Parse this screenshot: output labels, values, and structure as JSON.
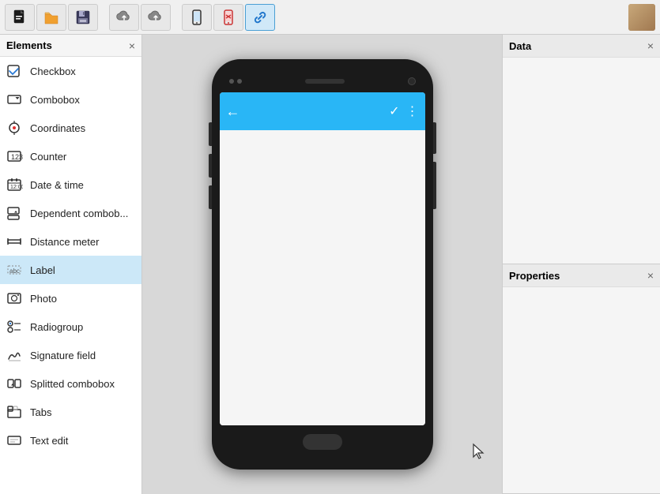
{
  "toolbar": {
    "buttons": [
      {
        "id": "new-file",
        "icon": "📄",
        "label": "New"
      },
      {
        "id": "open-folder",
        "icon": "📂",
        "label": "Open"
      },
      {
        "id": "save",
        "icon": "💾",
        "label": "Save"
      },
      {
        "id": "upload1",
        "icon": "☁",
        "label": "Upload1"
      },
      {
        "id": "upload2",
        "icon": "☁",
        "label": "Upload2"
      },
      {
        "id": "mobile-view",
        "icon": "📱",
        "label": "Mobile View"
      },
      {
        "id": "close-view",
        "icon": "🚫",
        "label": "Close View"
      },
      {
        "id": "link",
        "icon": "🔗",
        "label": "Link",
        "active": true
      }
    ]
  },
  "elements_panel": {
    "title": "Elements",
    "close_label": "×",
    "items": [
      {
        "id": "checkbox",
        "label": "Checkbox",
        "icon": "checkbox"
      },
      {
        "id": "combobox",
        "label": "Combobox",
        "icon": "combobox"
      },
      {
        "id": "coordinates",
        "label": "Coordinates",
        "icon": "coordinates"
      },
      {
        "id": "counter",
        "label": "Counter",
        "icon": "counter"
      },
      {
        "id": "datetime",
        "label": "Date & time",
        "icon": "datetime"
      },
      {
        "id": "dependent-combobox",
        "label": "Dependent combob...",
        "icon": "dependent"
      },
      {
        "id": "distance-meter",
        "label": "Distance meter",
        "icon": "distance"
      },
      {
        "id": "label",
        "label": "Label",
        "icon": "label",
        "selected": true
      },
      {
        "id": "photo",
        "label": "Photo",
        "icon": "photo"
      },
      {
        "id": "radiogroup",
        "label": "Radiogroup",
        "icon": "radiogroup"
      },
      {
        "id": "signature-field",
        "label": "Signature field",
        "icon": "signature"
      },
      {
        "id": "splitted-combobox",
        "label": "Splitted combobox",
        "icon": "splitted"
      },
      {
        "id": "tabs",
        "label": "Tabs",
        "icon": "tabs"
      },
      {
        "id": "text-edit",
        "label": "Text edit",
        "icon": "textedit"
      }
    ]
  },
  "phone": {
    "app_bar_back": "←",
    "app_bar_check": "✓",
    "app_bar_menu": "⋮"
  },
  "data_panel": {
    "title": "Data",
    "close_label": "×"
  },
  "properties_panel": {
    "title": "Properties",
    "close_label": "×"
  }
}
